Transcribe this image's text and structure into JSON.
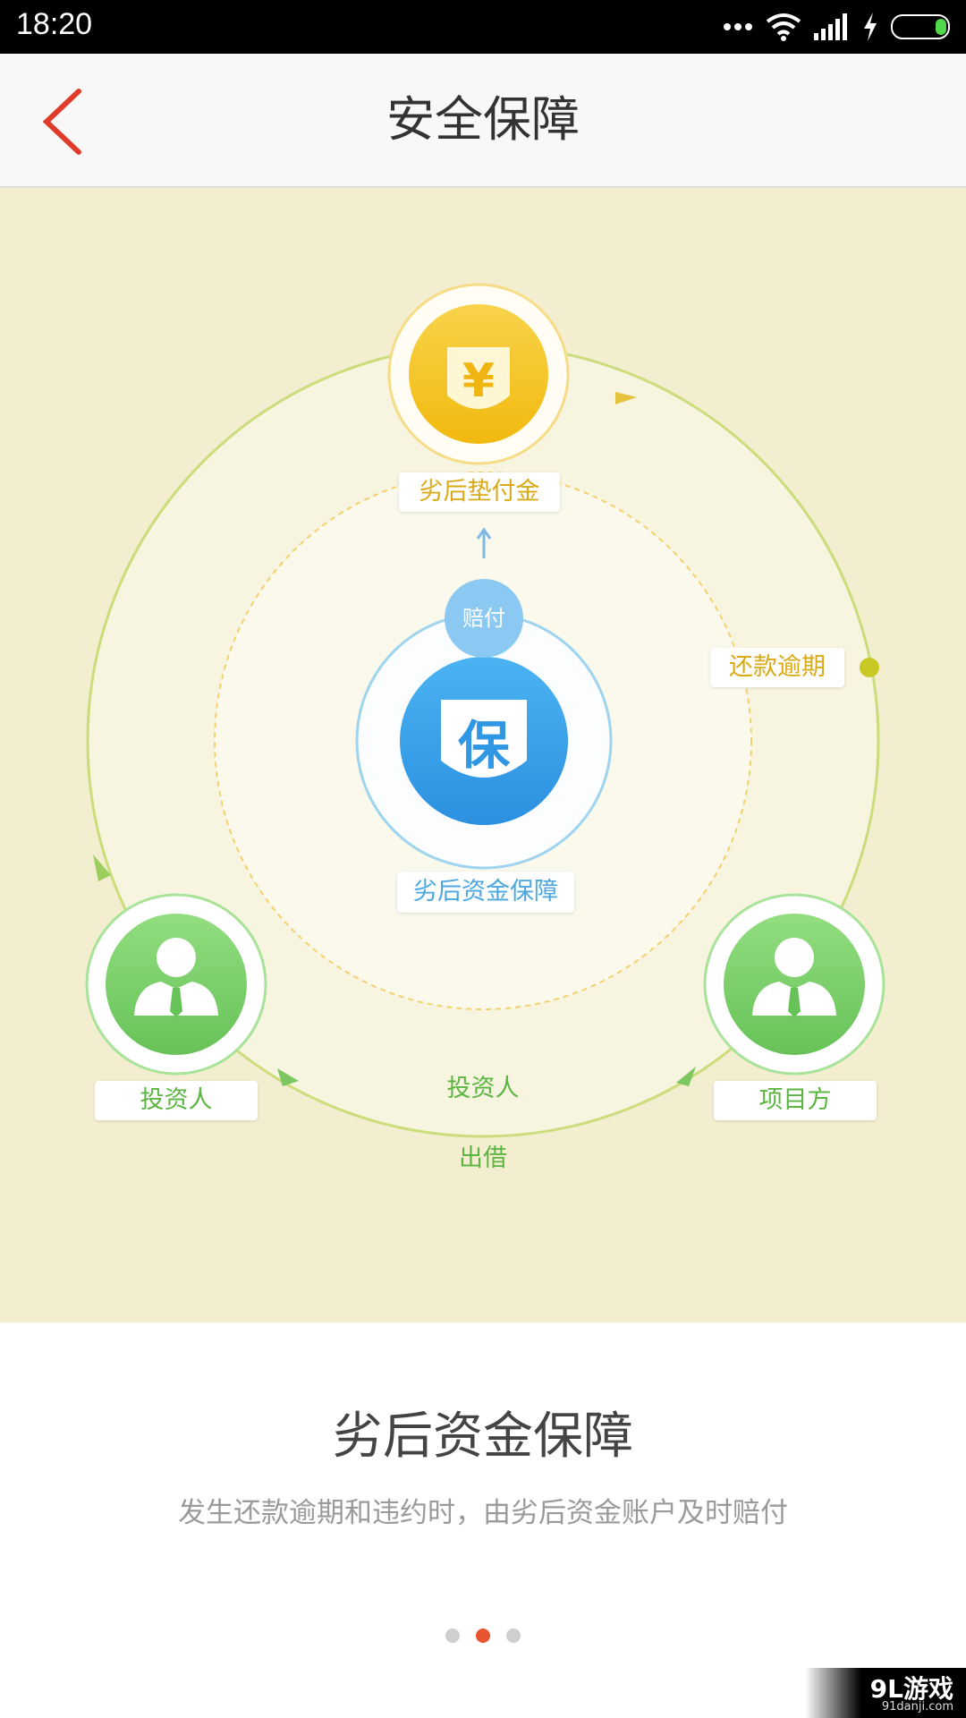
{
  "status_bar": {
    "time": "18:20",
    "icons": [
      "more-dots-icon",
      "wifi-icon",
      "signal-icon",
      "charging-icon",
      "battery-icon"
    ]
  },
  "nav": {
    "back_icon": "chevron-left-icon",
    "title": "安全保障"
  },
  "illustration": {
    "top_node": {
      "icon_text": "¥",
      "label": "劣后垫付金"
    },
    "center_node": {
      "icon_text": "保",
      "label": "劣后资金保障",
      "badge": "赔付"
    },
    "right_edge_label": "还款逾期",
    "left_node": {
      "label": "投资人"
    },
    "right_node": {
      "label": "项目方"
    },
    "flow_label_top": "投资人",
    "flow_label_bottom": "出借"
  },
  "content": {
    "title": "劣后资金保障",
    "description": "发生还款逾期和违约时，由劣后资金账户及时赔付"
  },
  "pagination": {
    "count": 3,
    "active": 2
  },
  "watermark": {
    "main": "9L游戏",
    "sub": "91danji.com"
  },
  "colors": {
    "accent_red": "#e8542f",
    "illustration_bg": "#f3eecf",
    "gold": "#f5c21b",
    "blue": "#3ea2e8",
    "green": "#7fd06d"
  }
}
